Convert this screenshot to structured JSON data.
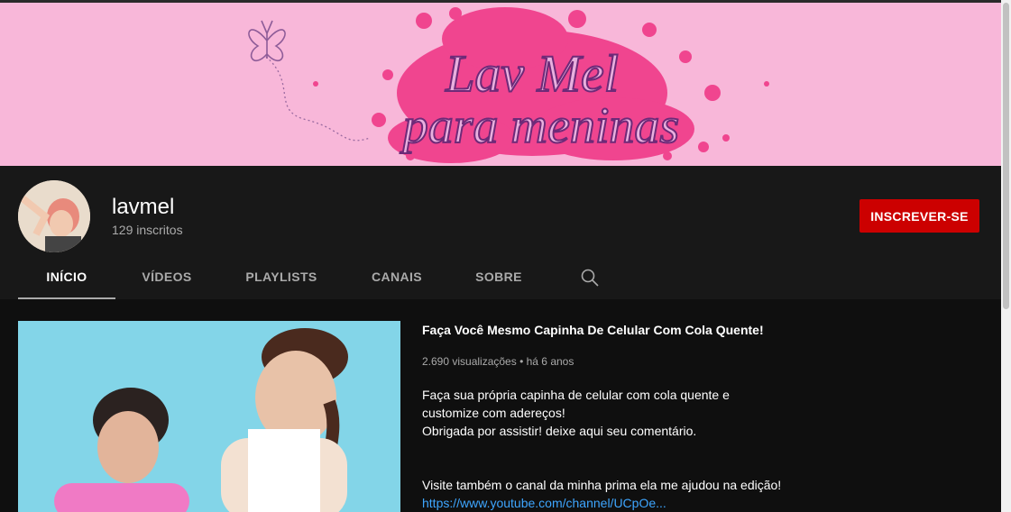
{
  "banner": {
    "title_line1": "Lav Mel",
    "title_line2": "para meninas"
  },
  "channel": {
    "name": "lavmel",
    "subscribers": "129 inscritos",
    "subscribe_label": "INSCREVER-SE"
  },
  "tabs": [
    {
      "label": "INÍCIO",
      "active": true
    },
    {
      "label": "VÍDEOS"
    },
    {
      "label": "PLAYLISTS"
    },
    {
      "label": "CANAIS"
    },
    {
      "label": "SOBRE"
    }
  ],
  "featured_video": {
    "title": "Faça Você Mesmo Capinha De Celular Com Cola Quente!",
    "views": "2.690 visualizações",
    "separator": "•",
    "age": "há 6 anos",
    "description_line1": "Faça sua própria capinha de celular com cola quente e",
    "description_line2": "customize com adereços!",
    "description_line3": "Obrigada por assistir! deixe aqui seu comentário.",
    "description_line4": "Visite também o canal da minha prima ela me ajudou na edição!",
    "link": "https://www.youtube.com/channel/UCpOe..."
  },
  "colors": {
    "banner_bg": "#f8b7d9",
    "splash": "#f0458f",
    "subscribe": "#cc0000",
    "link": "#3ea6ff"
  },
  "icons": [
    "butterfly-icon",
    "search-icon"
  ]
}
